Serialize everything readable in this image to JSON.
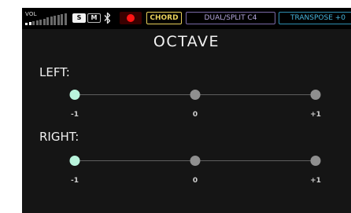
{
  "status_bar": {
    "vol_label": "VOL",
    "volume_level": 0.2,
    "solo_label": "S",
    "mute_label": "M",
    "bluetooth_icon": "bluetooth-icon",
    "record_icon": "record-icon",
    "chord_label": "CHORD",
    "dual_split_label": "DUAL/SPLIT  C4",
    "transpose_label": "TRANSPOSE +0",
    "colors": {
      "chord": "#e8d05a",
      "dual_split": "#7a6aa8",
      "transpose": "#2f8fb2",
      "record": "#ff1414"
    }
  },
  "page": {
    "title": "OCTAVE"
  },
  "octave": {
    "left": {
      "label": "LEFT:",
      "options": [
        "-1",
        "0",
        "+1"
      ],
      "selected": "-1"
    },
    "right": {
      "label": "RIGHT:",
      "options": [
        "-1",
        "0",
        "+1"
      ],
      "selected": "-1"
    }
  },
  "colors": {
    "selected_stop": "#b9f4dc",
    "unselected_stop": "#8f8f8f",
    "background": "#151515"
  }
}
